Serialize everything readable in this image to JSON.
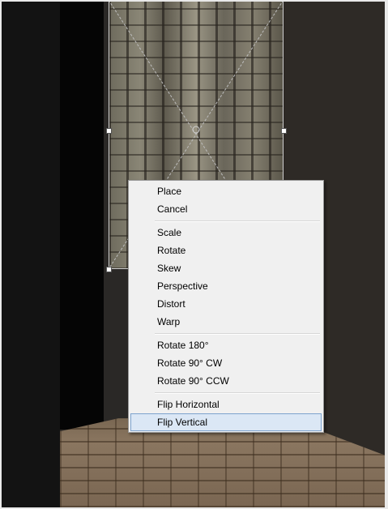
{
  "menu": {
    "groups": [
      [
        "Place",
        "Cancel"
      ],
      [
        "Scale",
        "Rotate",
        "Skew",
        "Perspective",
        "Distort",
        "Warp"
      ],
      [
        "Rotate 180°",
        "Rotate 90° CW",
        "Rotate 90° CCW"
      ],
      [
        "Flip Horizontal",
        "Flip Vertical"
      ]
    ],
    "highlighted": "Flip Vertical"
  }
}
